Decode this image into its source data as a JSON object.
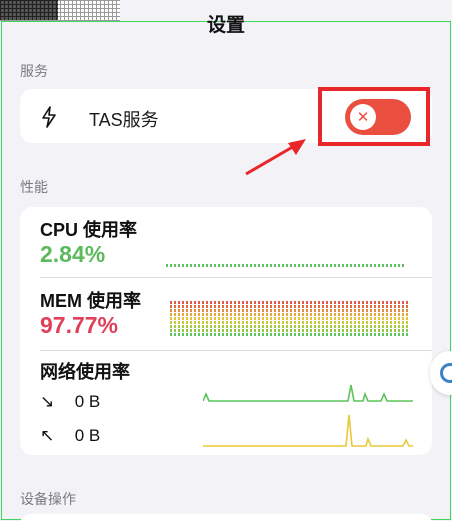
{
  "title": "设置",
  "sections": {
    "services": "服务",
    "performance": "性能",
    "device_actions": "设备操作"
  },
  "tas": {
    "label": "TAS服务",
    "icon": "bolt-icon",
    "enabled": false,
    "toggle_icon": "close-icon"
  },
  "cpu": {
    "title": "CPU 使用率",
    "value": "2.84%",
    "color": "#5cba5c"
  },
  "mem": {
    "title": "MEM 使用率",
    "value": "97.77%",
    "color": "#e0405a"
  },
  "network": {
    "title": "网络使用率",
    "download": {
      "icon": "arrow-down-right-icon",
      "value": "0 B",
      "color": "#5cc35c"
    },
    "upload": {
      "icon": "arrow-up-left-icon",
      "value": "0 B",
      "color": "#e8c93a"
    }
  },
  "colors": {
    "accent_red": "#ea4e3f",
    "highlight": "#e9262a",
    "mem_bar_colors": [
      "#e05a4a",
      "#e08a44",
      "#e6c23a",
      "#c9c93c",
      "#8cc84a",
      "#5cc35c"
    ]
  }
}
